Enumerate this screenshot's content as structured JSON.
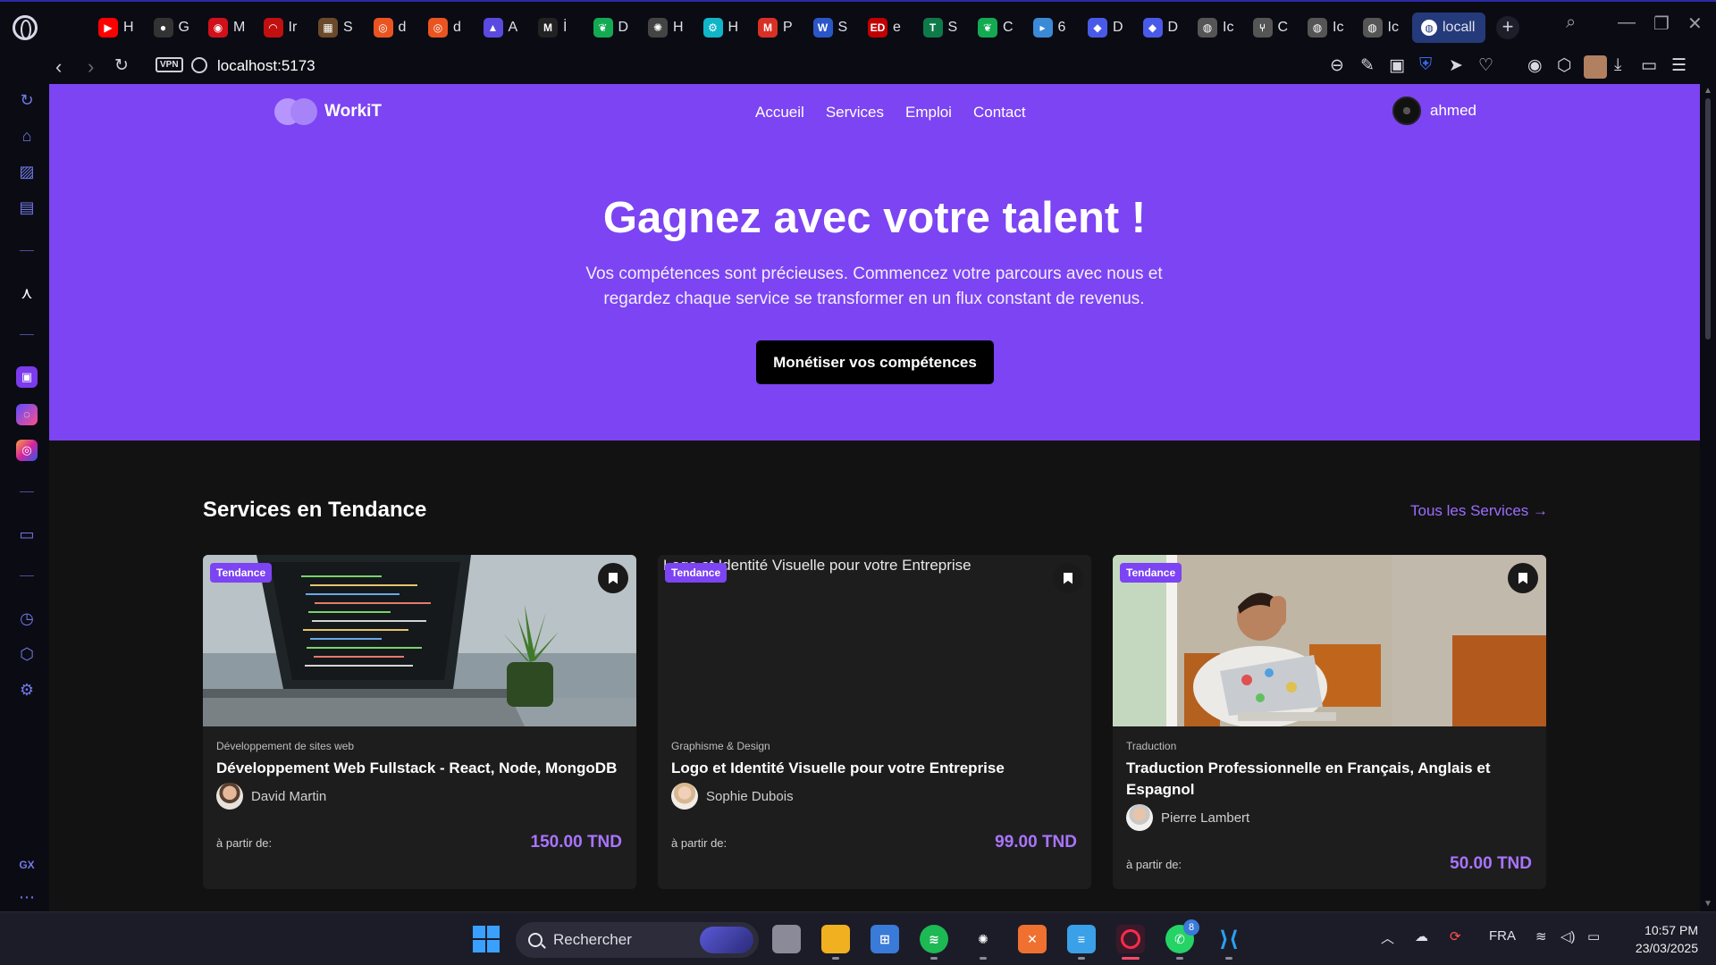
{
  "browser": {
    "tabs": [
      {
        "icon": "youtube-icon",
        "label": "H",
        "color": "#ff0000"
      },
      {
        "icon": "github-icon",
        "label": "G",
        "color": "#333333"
      },
      {
        "icon": "app-icon",
        "label": "M",
        "color": "#d0101a"
      },
      {
        "icon": "gauge-icon",
        "label": "Ir",
        "color": "#c01010"
      },
      {
        "icon": "image-icon",
        "label": "S",
        "color": "#6a4a2a"
      },
      {
        "icon": "ubuntu-icon",
        "label": "d",
        "color": "#e95420"
      },
      {
        "icon": "ubuntu-icon",
        "label": "d",
        "color": "#e95420"
      },
      {
        "icon": "triangle-icon",
        "label": "A",
        "color": "#5a4ae0"
      },
      {
        "icon": "m-icon",
        "label": "İ",
        "color": "#222222"
      },
      {
        "icon": "leaf-icon",
        "label": "D",
        "color": "#13aa52"
      },
      {
        "icon": "openai-icon",
        "label": "H",
        "color": "#444444"
      },
      {
        "icon": "settings-icon",
        "label": "H",
        "color": "#11b5c8"
      },
      {
        "icon": "gmail-icon",
        "label": "P",
        "color": "#d93025"
      },
      {
        "icon": "w-icon",
        "label": "S",
        "color": "#2b56c8"
      },
      {
        "icon": "ed-icon",
        "label": "e",
        "color": "#c00000"
      },
      {
        "icon": "t-icon",
        "label": "S",
        "color": "#0e7a4a"
      },
      {
        "icon": "leaf-icon",
        "label": "C",
        "color": "#13aa52"
      },
      {
        "icon": "play-icon",
        "label": "6",
        "color": "#3a8ad8"
      },
      {
        "icon": "cube-icon",
        "label": "D",
        "color": "#4a5ae8"
      },
      {
        "icon": "cube-icon",
        "label": "D",
        "color": "#4a5ae8"
      },
      {
        "icon": "globe-icon",
        "label": "Ic",
        "color": "#555555"
      },
      {
        "icon": "fork-icon",
        "label": "C",
        "color": "#555555"
      },
      {
        "icon": "globe-icon",
        "label": "Ic",
        "color": "#555555"
      },
      {
        "icon": "globe-icon",
        "label": "Ic",
        "color": "#555555"
      }
    ],
    "active_tab_label": "locall",
    "url": "localhost:5173",
    "vpn_label": "VPN"
  },
  "site": {
    "brand": "WorkiT",
    "nav": [
      "Accueil",
      "Services",
      "Emploi",
      "Contact"
    ],
    "username": "ahmed",
    "hero_title": "Gagnez avec votre talent !",
    "hero_subtitle": "Vos compétences sont précieuses. Commencez votre parcours avec nous et regardez chaque service se transformer en un flux constant de revenus.",
    "hero_cta": "Monétiser vos compétences",
    "section_title": "Services en Tendance",
    "section_link": "Tous les Services →"
  },
  "cards": [
    {
      "badge": "Tendance",
      "category": "Développement de sites web",
      "title": "Développement Web Fullstack - React, Node, MongoDB",
      "author": "David Martin",
      "price_label": "à partir de:",
      "price": "150.00 TND",
      "image": "laptop-code-photo"
    },
    {
      "badge": "Tendance",
      "category": "Graphisme & Design",
      "title": "Logo et Identité Visuelle pour votre Entreprise",
      "image_alt": "Logo et Identité Visuelle pour votre Entreprise",
      "author": "Sophie Dubois",
      "price_label": "à partir de:",
      "price": "99.00 TND",
      "image": "broken-image"
    },
    {
      "badge": "Tendance",
      "category": "Traduction",
      "title": "Traduction Professionnelle en Français, Anglais et Espagnol",
      "author": "Pierre Lambert",
      "price_label": "à partir de:",
      "price": "50.00 TND",
      "image": "stressed-man-laptop-photo"
    }
  ],
  "taskbar": {
    "search_placeholder": "Rechercher",
    "language": "FRA",
    "time": "10:57 PM",
    "date": "23/03/2025",
    "whatsapp_badge": "8"
  },
  "sidebar_bottom_label": "GX",
  "colors": {
    "accent": "#7c44f2",
    "price": "#a974ff",
    "page_bg": "#121212",
    "card_bg": "#1d1d1d"
  }
}
